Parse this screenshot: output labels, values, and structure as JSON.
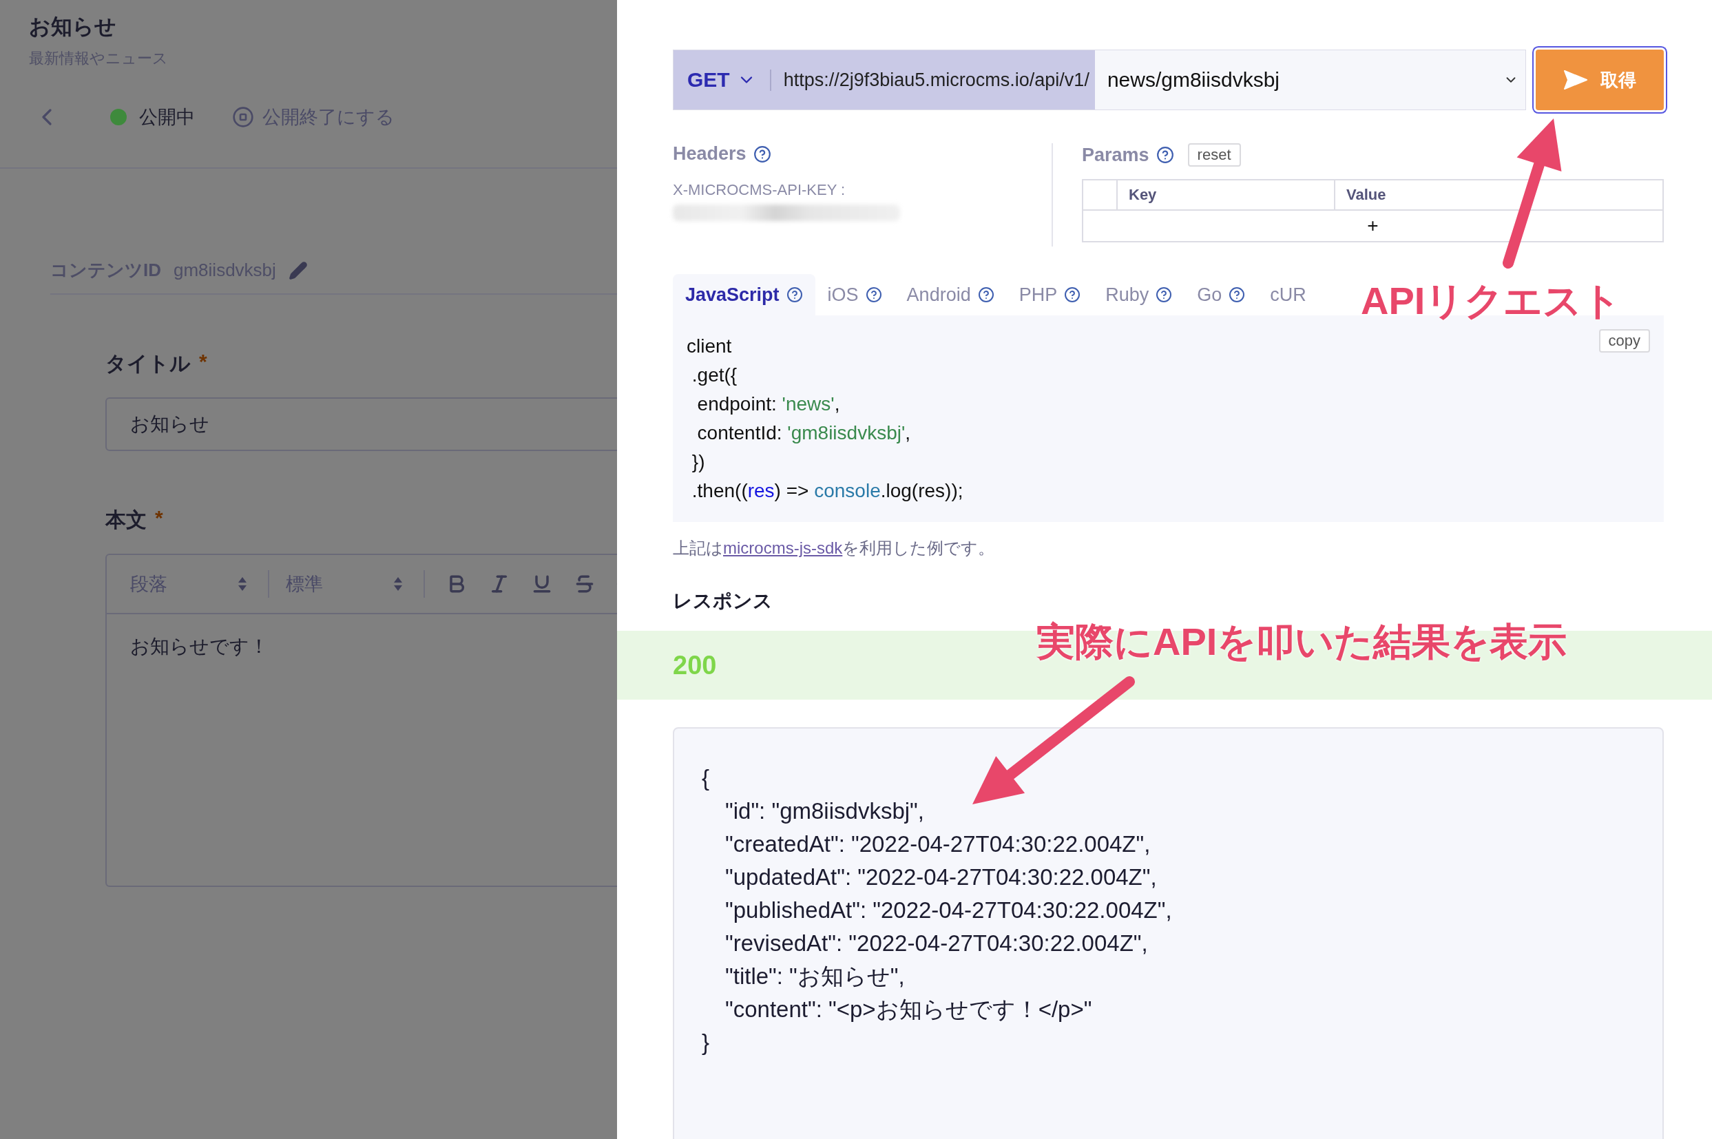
{
  "page": {
    "title": "お知らせ",
    "subtitle": "最新情報やニュース"
  },
  "status": {
    "label": "公開中",
    "published": true
  },
  "unpublish_action": "公開終了にする",
  "content_id": {
    "label": "コンテンツID",
    "value": "gm8iisdvksbj"
  },
  "fields": [
    {
      "kind": "text",
      "label": "タイトル",
      "required_mark": "*",
      "value": "お知らせ"
    },
    {
      "kind": "richtext",
      "label": "本文",
      "required_mark": "*",
      "block_format": "段落",
      "text_size": "標準",
      "value": "お知らせです！"
    }
  ],
  "request": {
    "method": "GET",
    "base_url": "https://2j9f3biau5.microcms.io/api/v1/",
    "endpoint": "news/gm8iisdvksbj",
    "submit": "取得"
  },
  "headers": {
    "title": "Headers",
    "key": "X-MICROCMS-API-KEY :"
  },
  "params": {
    "title": "Params",
    "reset": "reset",
    "columns": [
      "Key",
      "Value"
    ],
    "add": "+"
  },
  "tabs": [
    {
      "label": "JavaScript",
      "selected": true
    },
    {
      "label": "iOS",
      "selected": false
    },
    {
      "label": "Android",
      "selected": false
    },
    {
      "label": "PHP",
      "selected": false
    },
    {
      "label": "Ruby",
      "selected": false
    },
    {
      "label": "Go",
      "selected": false
    },
    {
      "label": "cUR",
      "selected": false
    }
  ],
  "code": {
    "copy": "copy",
    "lines": [
      [
        {
          "text": "client",
          "kind": "plain"
        }
      ],
      [
        {
          "text": " .get({",
          "kind": "plain"
        }
      ],
      [
        {
          "text": "  endpoint: ",
          "kind": "plain"
        },
        {
          "text": "'news'",
          "kind": "string"
        },
        {
          "text": ",",
          "kind": "plain"
        }
      ],
      [
        {
          "text": "  contentId: ",
          "kind": "plain"
        },
        {
          "text": "'gm8iisdvksbj'",
          "kind": "string"
        },
        {
          "text": ",",
          "kind": "plain"
        }
      ],
      [
        {
          "text": " })",
          "kind": "plain"
        }
      ],
      [
        {
          "text": " .then((",
          "kind": "plain"
        },
        {
          "text": "res",
          "kind": "variable"
        },
        {
          "text": ") => ",
          "kind": "plain"
        },
        {
          "text": "console",
          "kind": "builtin"
        },
        {
          "text": ".log(res));",
          "kind": "plain"
        }
      ]
    ]
  },
  "note": {
    "before": "上記は",
    "link": "microcms-js-sdk",
    "after": "を利用した例です。"
  },
  "response": {
    "title": "レスポンス",
    "status": "200",
    "open": "{",
    "entries": [
      "\"id\": \"gm8iisdvksbj\",",
      "\"createdAt\": \"2022-04-27T04:30:22.004Z\",",
      "\"updatedAt\": \"2022-04-27T04:30:22.004Z\",",
      "\"publishedAt\": \"2022-04-27T04:30:22.004Z\",",
      "\"revisedAt\": \"2022-04-27T04:30:22.004Z\",",
      "\"title\": \"お知らせ\",",
      "\"content\": \"<p>お知らせです！</p>\""
    ],
    "close": "}"
  },
  "annotations": [
    {
      "text": "APIリクエスト"
    },
    {
      "text": "実際にAPIを叩いた結果を表示"
    }
  ]
}
